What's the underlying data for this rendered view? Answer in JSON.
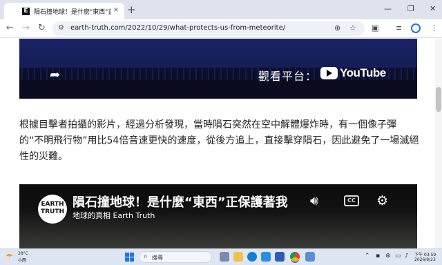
{
  "browser": {
    "tab_favicon": "E",
    "tab_title": "隕石撞地球！是什麼\"東西\"正保護",
    "tab_close": "×",
    "new_tab": "+",
    "window_controls": [
      "—",
      "❐",
      "✕"
    ],
    "url": "earth-truth.com/2022/10/29/what-protects-us-from-meteorite/",
    "icons": [
      "back-arrow-icon",
      "forward-arrow-icon",
      "reload-icon",
      "site-settings-icon",
      "zoom-icon",
      "bookmark-star-icon",
      "extensions-icon",
      "reading-list-icon",
      "profile-avatar-icon",
      "menu-icon"
    ]
  },
  "video1": {
    "watch_on": "觀看平台：",
    "brand": "YouTube"
  },
  "article": {
    "paragraph": "根據目擊者拍攝的影片，經過分析發現，當時隕石突然在空中解體爆炸時，有一個像子彈的“不明飛行物”用比54倍音速更快的速度，從後方追上，直接擊穿隕石，因此避免了一場滅絕性的災難。"
  },
  "video2": {
    "channel_logo_line1": "EARTH",
    "channel_logo_line2": "TRUTH",
    "title": "隕石撞地球！是什麼“東西”正保護著我",
    "channel": "地球的真相 Earth Truth",
    "cc_label": "CC"
  },
  "taskbar": {
    "weather_temp": "28°C",
    "weather_cond": "小雨",
    "search_placeholder": "搜尋",
    "time": "下午 03:59",
    "date": "2026/8/23",
    "accent_color": "#1a73e8"
  }
}
